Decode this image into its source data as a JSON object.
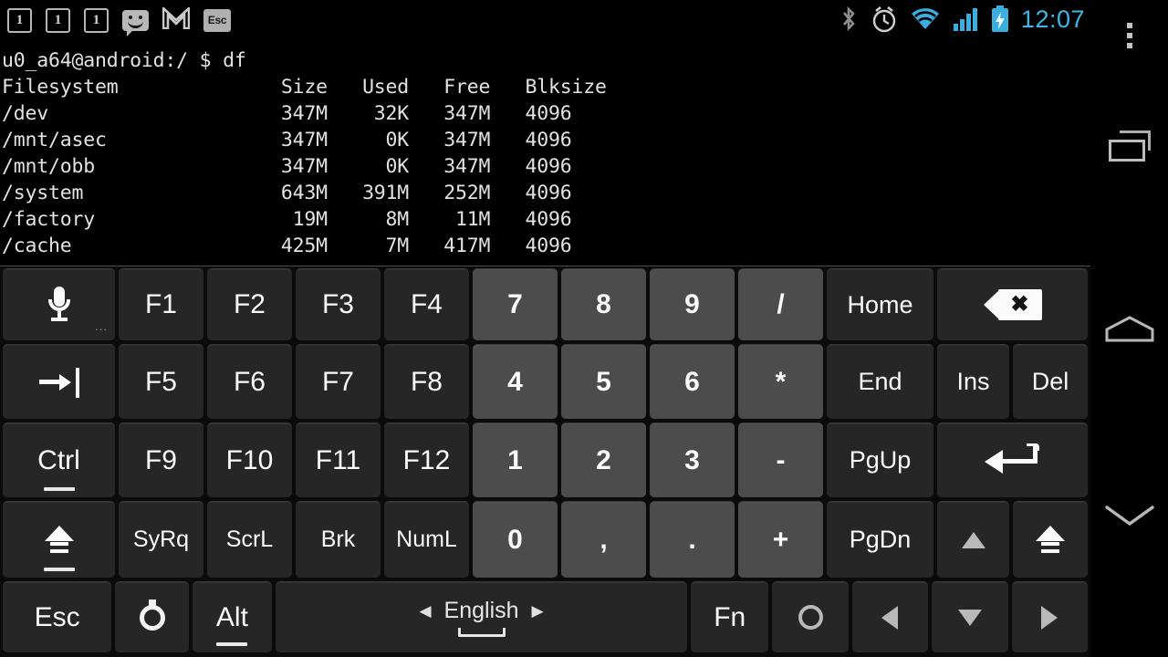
{
  "statusbar": {
    "notifications": [
      {
        "icon": "calendar-badge-icon",
        "label": "1"
      },
      {
        "icon": "calendar-badge-icon",
        "label": "1"
      },
      {
        "icon": "calendar-badge-icon",
        "label": "1"
      },
      {
        "icon": "sms-icon",
        "label": ""
      },
      {
        "icon": "gmail-icon",
        "label": "M"
      },
      {
        "icon": "terminal-esc-icon",
        "label": "Esc"
      }
    ],
    "system_icons": [
      "bluetooth-icon",
      "alarm-icon",
      "wifi-icon",
      "signal-icon",
      "battery-charging-icon"
    ],
    "clock": "12:07",
    "clock_color": "#41b6e6"
  },
  "terminal": {
    "text": "u0_a64@android:/ $ df\nFilesystem              Size   Used   Free   Blksize\n/dev                    347M    32K   347M   4096\n/mnt/asec               347M     0K   347M   4096\n/mnt/obb                347M     0K   347M   4096\n/system                 643M   391M   252M   4096\n/factory                 19M     8M    11M   4096\n/cache                  425M     7M   417M   4096",
    "prompt": "u0_a64@android:/ $",
    "command": "df",
    "columns": [
      "Filesystem",
      "Size",
      "Used",
      "Free",
      "Blksize"
    ],
    "rows": [
      {
        "Filesystem": "/dev",
        "Size": "347M",
        "Used": "32K",
        "Free": "347M",
        "Blksize": "4096"
      },
      {
        "Filesystem": "/mnt/asec",
        "Size": "347M",
        "Used": "0K",
        "Free": "347M",
        "Blksize": "4096"
      },
      {
        "Filesystem": "/mnt/obb",
        "Size": "347M",
        "Used": "0K",
        "Free": "347M",
        "Blksize": "4096"
      },
      {
        "Filesystem": "/system",
        "Size": "643M",
        "Used": "391M",
        "Free": "252M",
        "Blksize": "4096"
      },
      {
        "Filesystem": "/factory",
        "Size": "19M",
        "Used": "8M",
        "Free": "11M",
        "Blksize": "4096"
      },
      {
        "Filesystem": "/cache",
        "Size": "425M",
        "Used": "7M",
        "Free": "417M",
        "Blksize": "4096"
      }
    ]
  },
  "navbar": {
    "overflow": "overflow-menu-icon",
    "recents": "recent-apps-icon",
    "home": "home-icon",
    "back": "back-icon"
  },
  "keyboard": {
    "language": "English",
    "lang_prev": "◀",
    "lang_next": "▶",
    "row1": [
      {
        "name": "mic-key",
        "label": "",
        "icon": "microphone-icon",
        "type": "icon"
      },
      {
        "name": "f1-key",
        "label": "F1",
        "type": "fn"
      },
      {
        "name": "f2-key",
        "label": "F2",
        "type": "fn"
      },
      {
        "name": "f3-key",
        "label": "F3",
        "type": "fn"
      },
      {
        "name": "f4-key",
        "label": "F4",
        "type": "fn"
      },
      {
        "name": "num7-key",
        "label": "7",
        "type": "num"
      },
      {
        "name": "num8-key",
        "label": "8",
        "type": "num"
      },
      {
        "name": "num9-key",
        "label": "9",
        "type": "num"
      },
      {
        "name": "slash-key",
        "label": "/",
        "type": "num"
      },
      {
        "name": "home-key",
        "label": "Home",
        "type": "normal"
      },
      {
        "name": "backspace-key",
        "label": "",
        "icon": "backspace-icon",
        "type": "icon"
      }
    ],
    "row2": [
      {
        "name": "tab-key",
        "label": "",
        "icon": "tab-icon",
        "type": "icon"
      },
      {
        "name": "f5-key",
        "label": "F5",
        "type": "fn"
      },
      {
        "name": "f6-key",
        "label": "F6",
        "type": "fn"
      },
      {
        "name": "f7-key",
        "label": "F7",
        "type": "fn"
      },
      {
        "name": "f8-key",
        "label": "F8",
        "type": "fn"
      },
      {
        "name": "num4-key",
        "label": "4",
        "type": "num"
      },
      {
        "name": "num5-key",
        "label": "5",
        "type": "num"
      },
      {
        "name": "num6-key",
        "label": "6",
        "type": "num"
      },
      {
        "name": "asterisk-key",
        "label": "*",
        "type": "num"
      },
      {
        "name": "end-key",
        "label": "End",
        "type": "normal"
      },
      {
        "name": "ins-key",
        "label": "Ins",
        "type": "normal"
      },
      {
        "name": "del-key",
        "label": "Del",
        "type": "normal"
      }
    ],
    "row3": [
      {
        "name": "ctrl-key",
        "label": "Ctrl",
        "type": "mod"
      },
      {
        "name": "f9-key",
        "label": "F9",
        "type": "fn"
      },
      {
        "name": "f10-key",
        "label": "F10",
        "type": "fn"
      },
      {
        "name": "f11-key",
        "label": "F11",
        "type": "fn"
      },
      {
        "name": "f12-key",
        "label": "F12",
        "type": "fn"
      },
      {
        "name": "num1-key",
        "label": "1",
        "type": "num"
      },
      {
        "name": "num2-key",
        "label": "2",
        "type": "num"
      },
      {
        "name": "num3-key",
        "label": "3",
        "type": "num"
      },
      {
        "name": "minus-key",
        "label": "-",
        "type": "num"
      },
      {
        "name": "pgup-key",
        "label": "PgUp",
        "type": "normal"
      },
      {
        "name": "enter-key",
        "label": "",
        "icon": "enter-icon",
        "type": "icon"
      }
    ],
    "row4": [
      {
        "name": "shift-left-key",
        "label": "",
        "icon": "shift-icon",
        "type": "mod-icon"
      },
      {
        "name": "syrq-key",
        "label": "SyRq",
        "type": "fn"
      },
      {
        "name": "scrl-key",
        "label": "ScrL",
        "type": "fn"
      },
      {
        "name": "brk-key",
        "label": "Brk",
        "type": "fn"
      },
      {
        "name": "numl-key",
        "label": "NumL",
        "type": "fn"
      },
      {
        "name": "num0-key",
        "label": "0",
        "type": "num"
      },
      {
        "name": "comma-key",
        "label": ",",
        "type": "num"
      },
      {
        "name": "period-key",
        "label": ".",
        "type": "num"
      },
      {
        "name": "plus-key",
        "label": "+",
        "type": "num"
      },
      {
        "name": "pgdn-key",
        "label": "PgDn",
        "type": "normal"
      },
      {
        "name": "arrow-up-key",
        "label": "",
        "icon": "arrow-up-icon",
        "type": "arrow"
      },
      {
        "name": "shift-right-key",
        "label": "",
        "icon": "shift-icon",
        "type": "icon"
      }
    ],
    "row5": [
      {
        "name": "esc-key",
        "label": "Esc",
        "type": "normal"
      },
      {
        "name": "settings-key",
        "label": "",
        "icon": "settings-icon",
        "type": "icon"
      },
      {
        "name": "alt-key",
        "label": "Alt",
        "type": "mod"
      },
      {
        "name": "space-key",
        "label": "English",
        "type": "space"
      },
      {
        "name": "fn-key",
        "label": "Fn",
        "type": "normal"
      },
      {
        "name": "circle-key",
        "label": "",
        "icon": "circle-icon",
        "type": "icon"
      },
      {
        "name": "arrow-left-key",
        "label": "",
        "icon": "arrow-left-icon",
        "type": "arrow"
      },
      {
        "name": "arrow-down-key",
        "label": "",
        "icon": "arrow-down-icon",
        "type": "arrow"
      },
      {
        "name": "arrow-right-key",
        "label": "",
        "icon": "arrow-right-icon",
        "type": "arrow"
      }
    ]
  },
  "colors": {
    "key_bg": "#262626",
    "numpad_bg": "#4c4c4c",
    "keyboard_bg": "#0b0b0b",
    "terminal_fg": "#e2e2e2",
    "accent": "#41b6e6"
  }
}
